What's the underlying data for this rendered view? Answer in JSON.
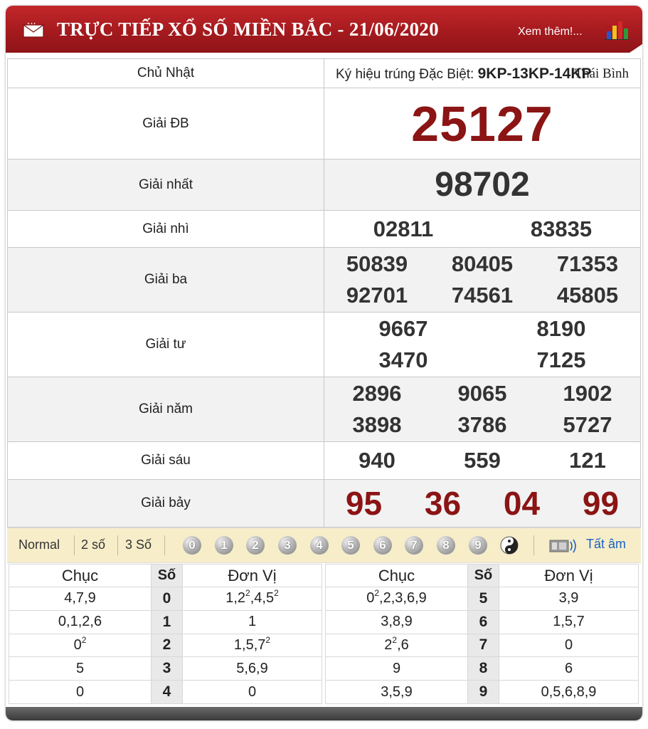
{
  "header": {
    "title": "TRỰC TIẾP XỔ SỐ MIỀN BẮC - 21/06/2020",
    "more_link": "Xem thêm!...",
    "mail_icon": "mail-icon",
    "chart_icon": "bar-chart-icon",
    "brand_color": "#b01f23"
  },
  "info": {
    "day": "Chủ Nhật",
    "symbol_label": "Ký hiệu trúng Đặc Biệt:",
    "symbol_code": "9KP-13KP-14KP",
    "province": "Thái Bình"
  },
  "prizes": {
    "db": {
      "label": "Giải ĐB",
      "numbers": [
        "25127"
      ]
    },
    "g1": {
      "label": "Giải nhất",
      "numbers": [
        "98702"
      ]
    },
    "g2": {
      "label": "Giải nhì",
      "numbers": [
        "02811",
        "83835"
      ]
    },
    "g3": {
      "label": "Giải ba",
      "numbers": [
        "50839",
        "80405",
        "71353",
        "92701",
        "74561",
        "45805"
      ]
    },
    "g4": {
      "label": "Giải tư",
      "numbers": [
        "9667",
        "8190",
        "3470",
        "7125"
      ]
    },
    "g5": {
      "label": "Giải năm",
      "numbers": [
        "2896",
        "9065",
        "1902",
        "3898",
        "3786",
        "5727"
      ]
    },
    "g6": {
      "label": "Giải sáu",
      "numbers": [
        "940",
        "559",
        "121"
      ]
    },
    "g7": {
      "label": "Giải bảy",
      "numbers": [
        "95",
        "36",
        "04",
        "99"
      ]
    }
  },
  "toolbar": {
    "options": [
      "Normal",
      "2 số",
      "3 Số"
    ],
    "digits": [
      "0",
      "1",
      "2",
      "3",
      "4",
      "5",
      "6",
      "7",
      "8",
      "9"
    ],
    "yin_yang_icon": "yin-yang-icon",
    "speaker_icon": "speaker-icon",
    "mute_label": "Tất âm"
  },
  "stats": {
    "headers": {
      "chuc": "Chục",
      "so": "Số",
      "donvi": "Đơn Vị"
    },
    "left": [
      {
        "chuc": "4,7,9",
        "so": "0",
        "donvi": "1,2<sup>2</sup>,4,5<sup>2</sup>"
      },
      {
        "chuc": "0,1,2,6",
        "so": "1",
        "donvi": "1"
      },
      {
        "chuc": "0<sup>2</sup>",
        "so": "2",
        "donvi": "1,5,7<sup>2</sup>"
      },
      {
        "chuc": "5",
        "so": "3",
        "donvi": "5,6,9"
      },
      {
        "chuc": "0",
        "so": "4",
        "donvi": "0"
      }
    ],
    "right": [
      {
        "chuc": "0<sup>2</sup>,2,3,6,9",
        "so": "5",
        "donvi": "3,9"
      },
      {
        "chuc": "3,8,9",
        "so": "6",
        "donvi": "1,5,7"
      },
      {
        "chuc": "2<sup>2</sup>,6",
        "so": "7",
        "donvi": "0"
      },
      {
        "chuc": "9",
        "so": "8",
        "donvi": "6"
      },
      {
        "chuc": "3,5,9",
        "so": "9",
        "donvi": "0,5,6,8,9"
      }
    ]
  }
}
